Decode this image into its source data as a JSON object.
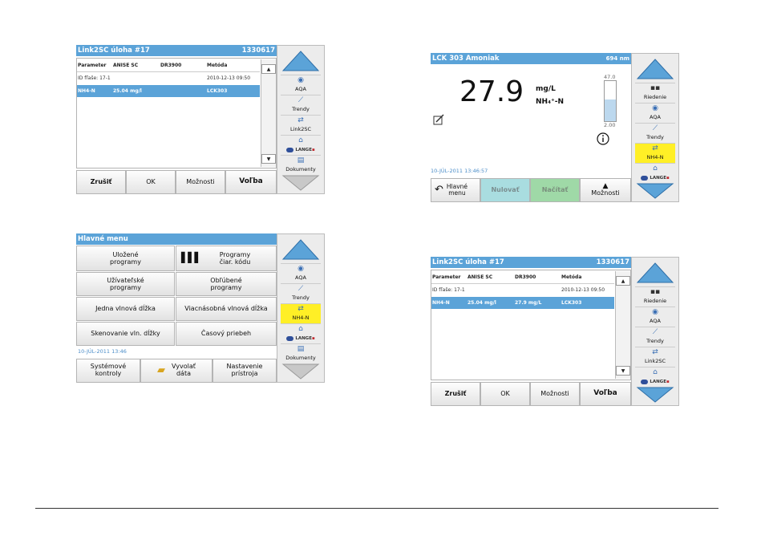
{
  "screen1": {
    "title": "Link2SC úloha #17",
    "title_id": "1330617",
    "headers": [
      "Parameter",
      "ANISE SC",
      "DR3900",
      "Metóda"
    ],
    "row1": [
      "ID fľaše: 17-1",
      "2010-12-13 09:50"
    ],
    "row2": [
      "NH4-N",
      "25.04 mg/l",
      "LCK303"
    ],
    "scroll_up": "▲",
    "scroll_down": "▼",
    "buttons": [
      "Zrušiť",
      "OK",
      "Možnosti",
      "Voľba"
    ],
    "side": [
      "AQA",
      "Trendy",
      "Link2SC",
      "LANGE",
      "Dokumenty"
    ]
  },
  "screen2": {
    "title": "LCK 303 Amoniak",
    "wavelength": "694 nm",
    "value": "27.9",
    "unit": "mg/L",
    "species": "NH₄⁺-N",
    "range_max": "47.0",
    "range_min": "2.00",
    "range_fill": 0.55,
    "date": "10-JÚL-2011  13:46:57",
    "buttons": [
      "Hlavné\nmenu",
      "Nulovať",
      "Načítať",
      "Možnosti"
    ],
    "side": [
      "Riedenie",
      "AQA",
      "Trendy",
      "NH4-N",
      "LANGE"
    ]
  },
  "screen3": {
    "title": "Hlavné menu",
    "items": [
      "Uložené\nprogramy",
      "Programy\nčiar. kódu",
      "Užívateľské\nprogramy",
      "Obľúbené\nprogramy",
      "Jedna vlnová dĺžka",
      "Viacnásobná vlnová dĺžka",
      "Skenovanie vln. dĺžky",
      "Časový priebeh"
    ],
    "date": "10-JÚL-2011  13:46",
    "buttons": [
      "Systémové\nkontroly",
      "Vyvolať\ndáta",
      "Nastavenie\nprístroja"
    ],
    "side": [
      "AQA",
      "Trendy",
      "NH4-N",
      "LANGE",
      "Dokumenty"
    ]
  },
  "screen4": {
    "title": "Link2SC úloha #17",
    "title_id": "1330617",
    "headers": [
      "Parameter",
      "ANISE SC",
      "DR3900",
      "Metóda"
    ],
    "row1": [
      "ID fľaše: 17-1",
      "2010-12-13 09:50"
    ],
    "row2": [
      "NH4-N",
      "25.04 mg/l",
      "27.9 mg/L",
      "LCK303"
    ],
    "scroll_up": "▲",
    "scroll_down": "▼",
    "buttons": [
      "Zrušiť",
      "OK",
      "Možnosti",
      "Voľba"
    ],
    "side": [
      "Riedenie",
      "AQA",
      "Trendy",
      "Link2SC",
      "LANGE"
    ]
  },
  "colors": {
    "title_bar": "#5ba3d8",
    "highlight": "#ffef26",
    "nulovat": "#a9dde0",
    "nacitat": "#9fd9a7"
  }
}
